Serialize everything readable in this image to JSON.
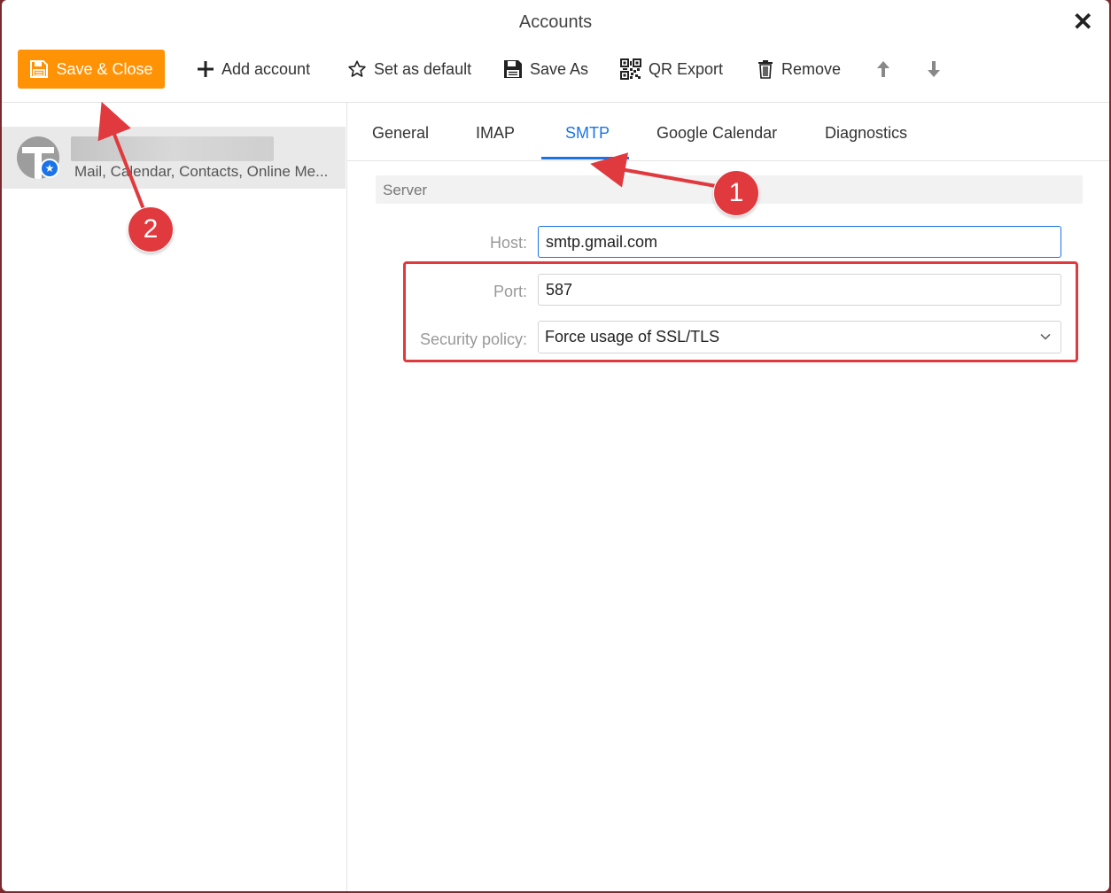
{
  "window": {
    "title": "Accounts"
  },
  "toolbar": {
    "save_close": "Save & Close",
    "add_account": "Add account",
    "set_default": "Set as default",
    "save_as": "Save As",
    "qr_export": "QR Export",
    "remove": "Remove"
  },
  "sidebar": {
    "account": {
      "subtitle": "Mail, Calendar, Contacts, Online Me..."
    }
  },
  "tabs": [
    "General",
    "IMAP",
    "SMTP",
    "Google Calendar",
    "Diagnostics"
  ],
  "active_tab": "SMTP",
  "section": {
    "title": "Server"
  },
  "form": {
    "host_label": "Host:",
    "host_value": "smtp.gmail.com",
    "port_label": "Port:",
    "port_value": "587",
    "security_label": "Security policy:",
    "security_value": "Force usage of SSL/TLS"
  },
  "annotations": {
    "badge1": "1",
    "badge2": "2"
  },
  "colors": {
    "accent": "#ff9205",
    "tab_active": "#1a73e8",
    "annotation": "#e0393e"
  }
}
